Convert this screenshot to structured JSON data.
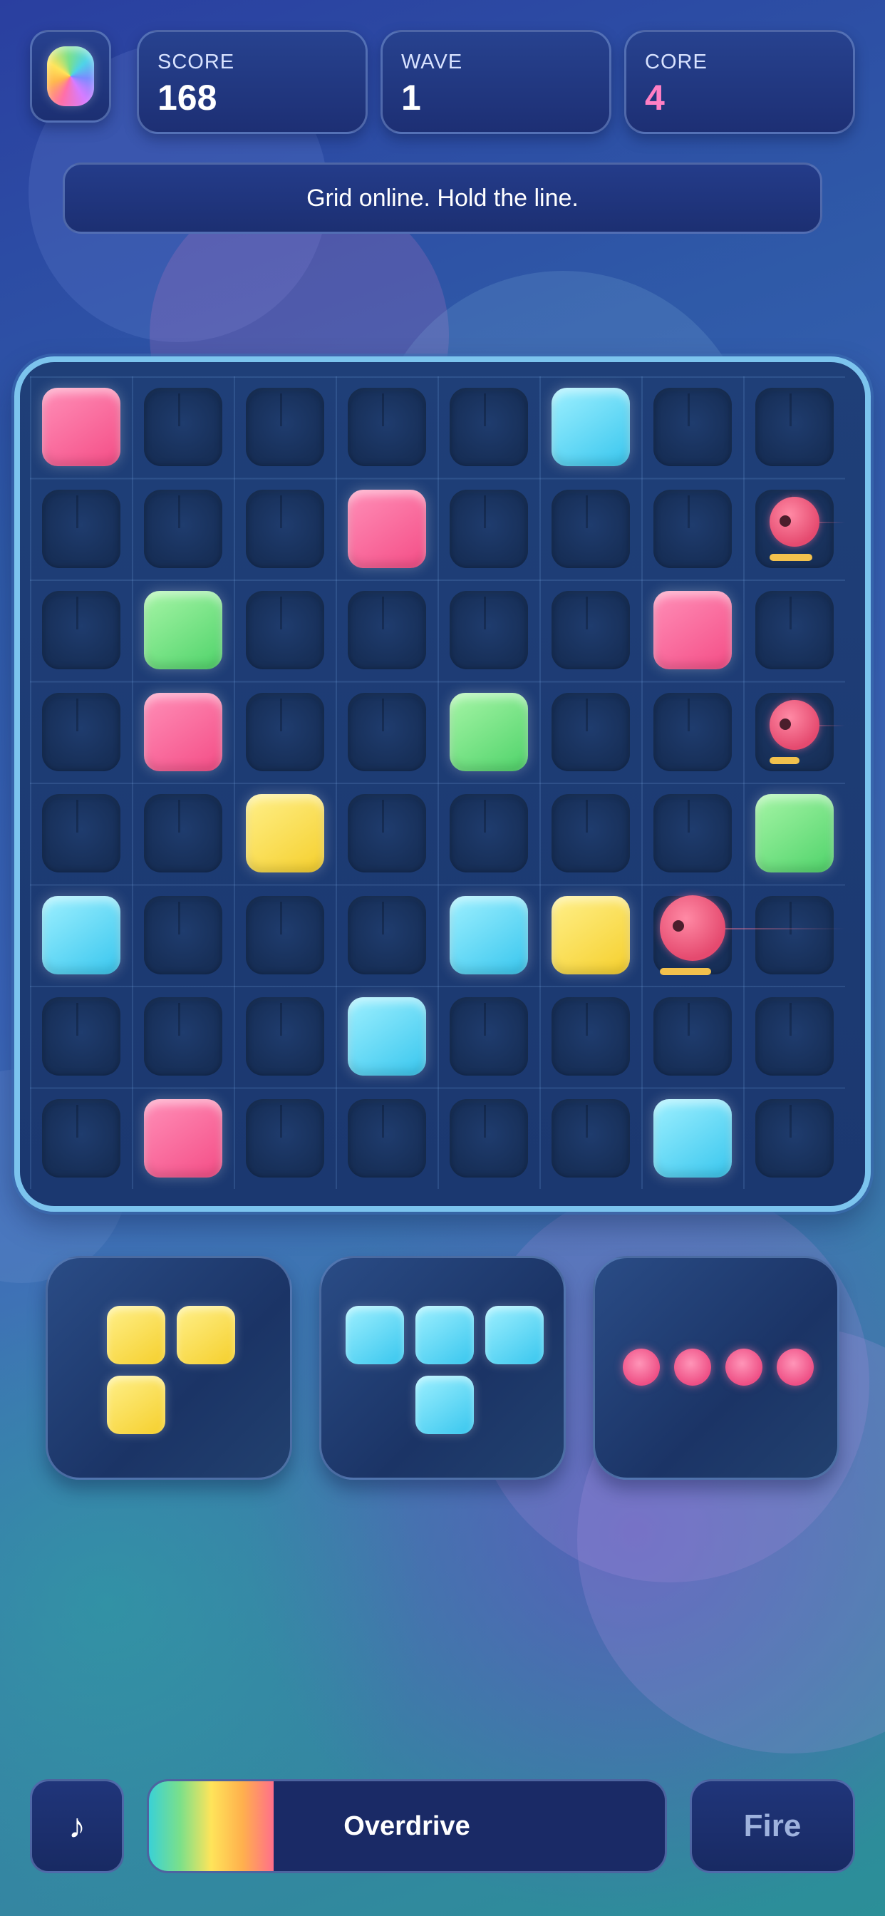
{
  "hud": {
    "score_label": "SCORE",
    "score_value": "168",
    "wave_label": "WAVE",
    "wave_value": "1",
    "core_label": "CORE",
    "core_value": "4",
    "core_color": "#ff7fc4"
  },
  "message": "Grid online. Hold the line.",
  "board": {
    "rows": 8,
    "cols": 8,
    "blocks": [
      {
        "row": 0,
        "col": 0,
        "color": "pink"
      },
      {
        "row": 0,
        "col": 5,
        "color": "blue"
      },
      {
        "row": 1,
        "col": 3,
        "color": "pink"
      },
      {
        "row": 2,
        "col": 1,
        "color": "green"
      },
      {
        "row": 2,
        "col": 6,
        "color": "pink"
      },
      {
        "row": 3,
        "col": 1,
        "color": "pink"
      },
      {
        "row": 3,
        "col": 4,
        "color": "green"
      },
      {
        "row": 4,
        "col": 2,
        "color": "yellow"
      },
      {
        "row": 4,
        "col": 7,
        "color": "green"
      },
      {
        "row": 5,
        "col": 0,
        "color": "blue"
      },
      {
        "row": 5,
        "col": 4,
        "color": "blue"
      },
      {
        "row": 5,
        "col": 5,
        "color": "yellow"
      },
      {
        "row": 6,
        "col": 3,
        "color": "blue"
      },
      {
        "row": 7,
        "col": 1,
        "color": "pink"
      },
      {
        "row": 7,
        "col": 6,
        "color": "blue"
      }
    ],
    "enemies": [
      {
        "row": 1,
        "col": 7,
        "health": 0.5
      },
      {
        "row": 3,
        "col": 7,
        "health": 0.35
      },
      {
        "row": 5,
        "col": 6,
        "health": 0.6
      }
    ]
  },
  "tray": [
    {
      "name": "l-piece",
      "color": "yellow",
      "cells": [
        [
          0,
          0
        ],
        [
          0,
          1
        ],
        [
          1,
          0
        ]
      ]
    },
    {
      "name": "t-piece",
      "color": "blue",
      "cells": [
        [
          0,
          0
        ],
        [
          0,
          1
        ],
        [
          0,
          2
        ],
        [
          1,
          1
        ]
      ]
    },
    {
      "name": "line-bomb",
      "color": "pink",
      "cells": [
        [
          0,
          0
        ],
        [
          0,
          1
        ],
        [
          0,
          2
        ],
        [
          0,
          3
        ]
      ]
    }
  ],
  "controls": {
    "music_icon": "music-note-icon",
    "music_glyph": "♪",
    "overdrive_label": "Overdrive",
    "overdrive_fill": 0.24,
    "fire_label": "Fire"
  }
}
